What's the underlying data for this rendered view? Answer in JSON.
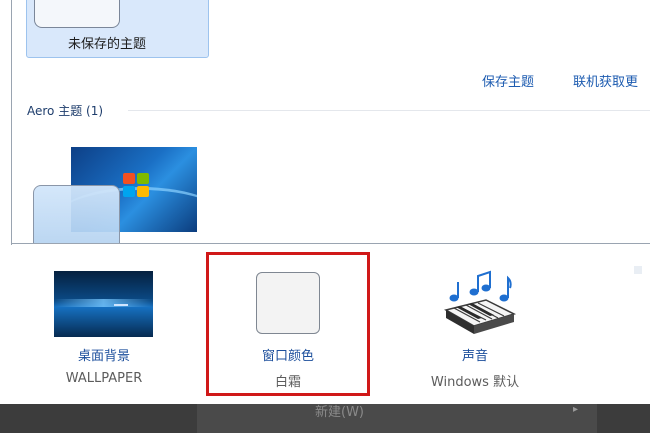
{
  "themes": {
    "selected_theme_label": "未保存的主题",
    "links": {
      "save": "保存主题",
      "online": "联机获取更"
    },
    "aero_section_title": "Aero 主题 (1)"
  },
  "customize": {
    "desktop_background": {
      "title": "桌面背景",
      "value": "WALLPAPER"
    },
    "window_color": {
      "title": "窗口颜色",
      "value": "白霜"
    },
    "sounds": {
      "title": "声音",
      "value": "Windows 默认"
    }
  },
  "taskbar": {
    "menu_text": "新建(W)",
    "arrow": "▸"
  },
  "colors": {
    "link": "#1c5bb0",
    "highlight": "#d01818",
    "selected_bg": "#d9e8fb",
    "taskbar": "#3c3c3c"
  },
  "icons": [
    "windows-logo-icon",
    "music-notes-icon",
    "piano-keyboard-icon"
  ]
}
